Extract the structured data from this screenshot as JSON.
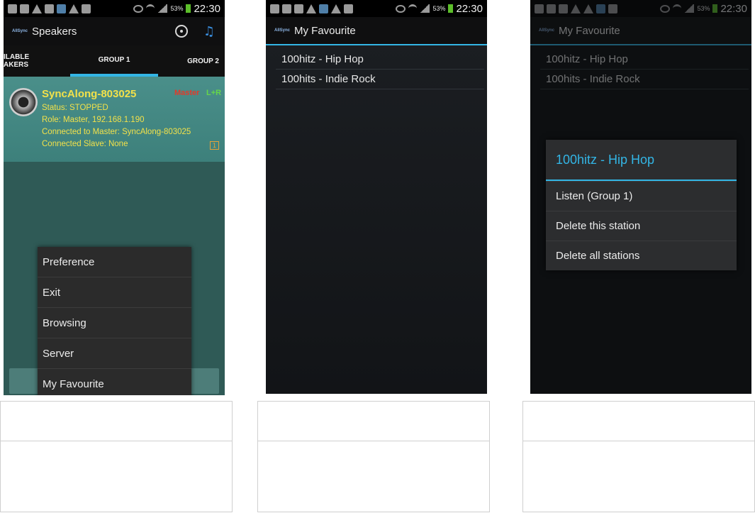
{
  "status_bar": {
    "battery": "53%",
    "time": "22:30"
  },
  "app_logo": "AllSync",
  "screen1": {
    "title": "Speakers",
    "tabs": [
      "ILABLE\nAKERS",
      "GROUP 1",
      "GROUP 2"
    ],
    "speaker": {
      "name": "SyncAlong-803025",
      "role_badge": "Master",
      "channel": "L+R",
      "status": "Status: STOPPED",
      "role": "Role: Master,  192.168.1.190",
      "connected_master": "Connected to Master: SyncAlong-803025",
      "connected_slave": "Connected Slave: None",
      "group_badge": "1"
    },
    "menu": [
      "Preference",
      "Exit",
      "Browsing",
      "Server",
      "My Favourite"
    ]
  },
  "screen2": {
    "title": "My Favourite",
    "stations": [
      "100hitz - Hip Hop",
      "100hits - Indie Rock"
    ]
  },
  "screen3": {
    "title": "My Favourite",
    "stations": [
      "100hitz - Hip Hop",
      "100hits - Indie Rock"
    ],
    "dialog": {
      "title": "100hitz - Hip Hop",
      "options": [
        "Listen (Group 1)",
        "Delete this station",
        "Delete all stations"
      ]
    }
  }
}
